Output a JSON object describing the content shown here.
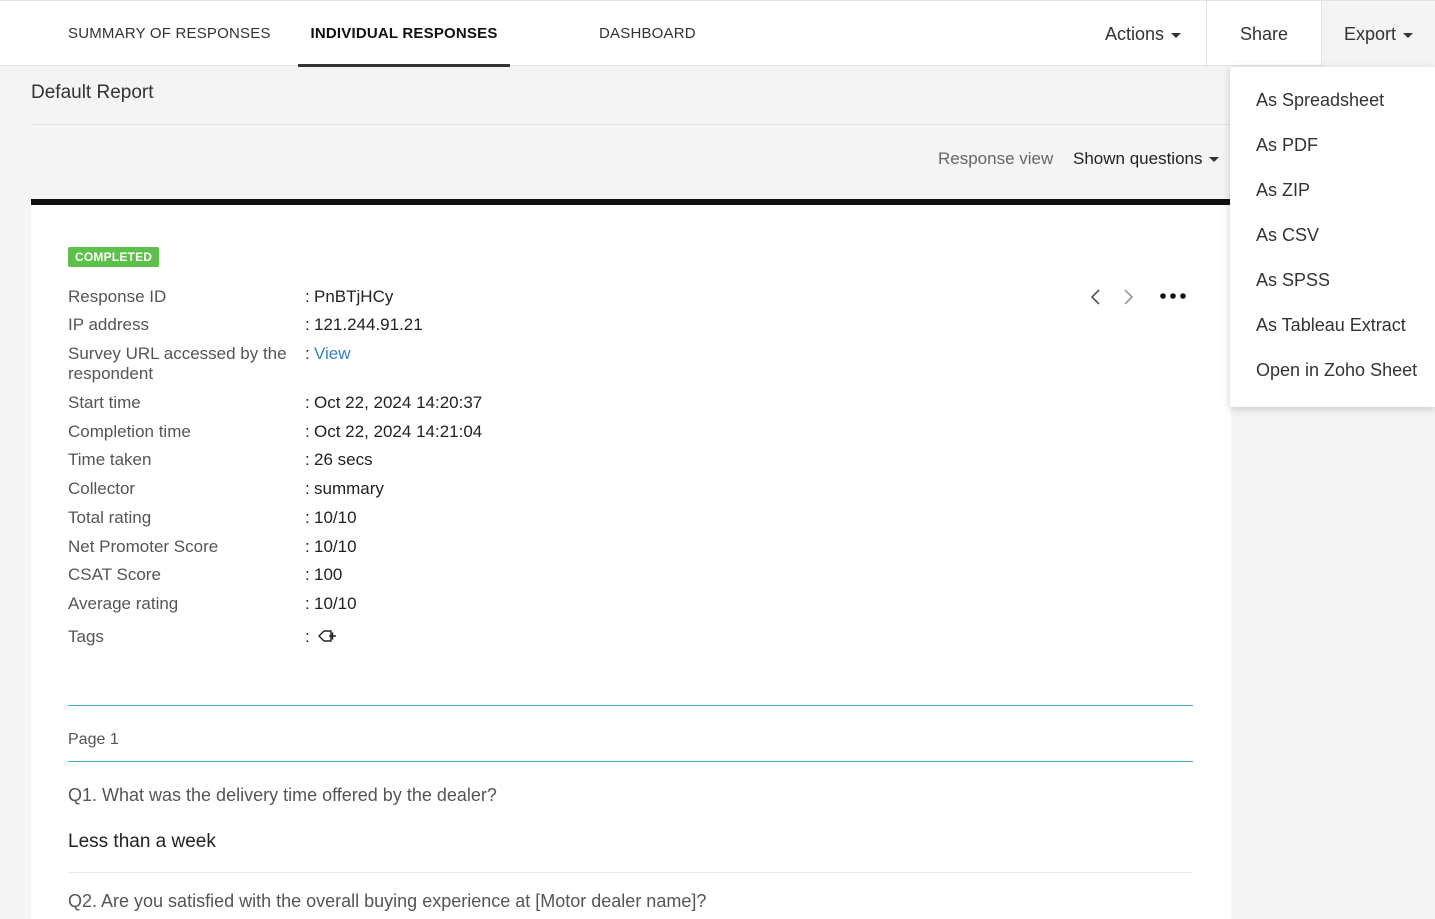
{
  "tabs": [
    {
      "label": "SUMMARY OF RESPONSES"
    },
    {
      "label": "INDIVIDUAL RESPONSES"
    },
    {
      "label": "DASHBOARD"
    }
  ],
  "toolbar": {
    "actions_label": "Actions",
    "share_label": "Share",
    "export_label": "Export"
  },
  "report_title": "Default Report",
  "response_view": {
    "label": "Response view",
    "selected": "Shown questions"
  },
  "response": {
    "status": "COMPLETED",
    "fields": [
      {
        "label": "Response ID",
        "value": "PnBTjHCy"
      },
      {
        "label": "IP address",
        "value": "121.244.91.21"
      },
      {
        "label": "Survey URL accessed by the respondent",
        "value": "View"
      },
      {
        "label": "Start time",
        "value": "Oct 22, 2024 14:20:37"
      },
      {
        "label": "Completion time",
        "value": "Oct 22, 2024 14:21:04"
      },
      {
        "label": "Time taken",
        "value": "26 secs"
      },
      {
        "label": "Collector",
        "value": "summary"
      },
      {
        "label": "Total rating",
        "value": "10/10"
      },
      {
        "label": "Net Promoter Score",
        "value": "10/10"
      },
      {
        "label": "CSAT Score",
        "value": "100"
      },
      {
        "label": "Average rating",
        "value": "10/10"
      },
      {
        "label": "Tags",
        "value": ""
      }
    ],
    "colon": ":",
    "tag_icon": "add-tag-icon"
  },
  "page_label": "Page 1",
  "questions": [
    {
      "text": "Q1. What was the delivery time offered by the dealer?",
      "answer": "Less than a week"
    },
    {
      "text": "Q2. Are you satisfied with the overall buying experience at [Motor dealer name]?"
    }
  ],
  "export_menu": [
    "As Spreadsheet",
    "As PDF",
    "As ZIP",
    "As CSV",
    "As SPSS",
    "As Tableau Extract",
    "Open in Zoho Sheet"
  ],
  "colors": {
    "badge": "#5cc04a",
    "link": "#3d7fc1",
    "page_separator": "#4ba9c8"
  }
}
